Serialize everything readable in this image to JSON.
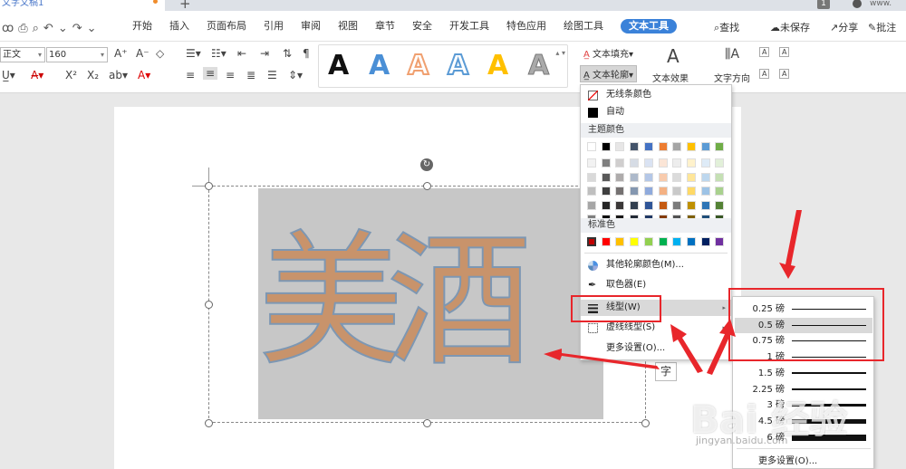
{
  "window": {
    "tab_title": "文字文稿1",
    "page_indicator": "1",
    "account": "www."
  },
  "menu": {
    "items": [
      "开始",
      "插入",
      "页面布局",
      "引用",
      "审阅",
      "视图",
      "章节",
      "安全",
      "开发工具",
      "特色应用",
      "绘图工具",
      "文本工具"
    ],
    "active": "文本工具",
    "search": "查找",
    "unsaved": "未保存",
    "share": "分享",
    "comment": "批注"
  },
  "toolbar": {
    "style_value": "正文",
    "font_size": "160",
    "text_fill": "文本填充",
    "text_outline": "文本轮廓",
    "text_effect": "文本效果",
    "text_direction": "文字方向"
  },
  "wordart": [
    {
      "color": "#111111",
      "style": "solid"
    },
    {
      "color": "#4a8fd6",
      "style": "solid"
    },
    {
      "color": "#f0a070",
      "style": "outline"
    },
    {
      "color": "#5b9bd5",
      "style": "outline"
    },
    {
      "color": "#ffc000",
      "style": "solid"
    },
    {
      "color": "#aaaaaa",
      "style": "gradient"
    }
  ],
  "document": {
    "text": "美酒",
    "box_char": "字"
  },
  "dropdown": {
    "no_line": "无线条颜色",
    "auto": "自动",
    "theme_colors": "主题颜色",
    "standard_colors": "标准色",
    "more_colors": "其他轮廓颜色(M)...",
    "eyedropper": "取色器(E)",
    "line_type": "线型(W)",
    "dash_type": "虚线线型(S)",
    "more_settings": "更多设置(O)...",
    "theme_row": [
      "#ffffff",
      "#000000",
      "#e7e6e6",
      "#44546a",
      "#4472c4",
      "#ed7d31",
      "#a5a5a5",
      "#ffc000",
      "#5b9bd5",
      "#70ad47"
    ],
    "theme_shades": [
      [
        "#f2f2f2",
        "#7f7f7f",
        "#d0cece",
        "#d6dce5",
        "#dae3f3",
        "#fbe5d6",
        "#ededed",
        "#fff2cc",
        "#deebf7",
        "#e2f0d9"
      ],
      [
        "#d9d9d9",
        "#595959",
        "#aeabab",
        "#adb9ca",
        "#b4c7e7",
        "#f8cbad",
        "#dbdbdb",
        "#ffe699",
        "#bdd7ee",
        "#c5e0b4"
      ],
      [
        "#bfbfbf",
        "#3f3f3f",
        "#757171",
        "#8497b0",
        "#8faadc",
        "#f4b183",
        "#c9c9c9",
        "#ffd966",
        "#9dc3e6",
        "#a9d18e"
      ],
      [
        "#a6a6a6",
        "#262626",
        "#3b3838",
        "#323f4f",
        "#2f5597",
        "#c55a11",
        "#7b7b7b",
        "#bf9000",
        "#2e75b6",
        "#548235"
      ],
      [
        "#7f7f7f",
        "#0d0d0d",
        "#171616",
        "#222a35",
        "#1f3864",
        "#843c0c",
        "#525252",
        "#7f6000",
        "#1f4e79",
        "#375623"
      ]
    ],
    "standard_row": [
      "#c00000",
      "#ff0000",
      "#ffc000",
      "#ffff00",
      "#92d050",
      "#00b050",
      "#00b0f0",
      "#0070c0",
      "#002060",
      "#7030a0"
    ]
  },
  "line_weights": [
    {
      "label": "0.25 磅",
      "weight": 0.25
    },
    {
      "label": "0.5 磅",
      "weight": 0.5
    },
    {
      "label": "0.75 磅",
      "weight": 0.75
    },
    {
      "label": "1 磅",
      "weight": 1
    },
    {
      "label": "1.5 磅",
      "weight": 1.5
    },
    {
      "label": "2.25 磅",
      "weight": 2.25
    },
    {
      "label": "3 磅",
      "weight": 3
    },
    {
      "label": "4.5 磅",
      "weight": 4.5
    },
    {
      "label": "6 磅",
      "weight": 6
    }
  ],
  "line_weight_selected": "0.5 磅",
  "submenu_more": "更多设置(O)...",
  "watermark": {
    "main": "Bai 经验",
    "sub": "jingyan.baidu.com"
  }
}
